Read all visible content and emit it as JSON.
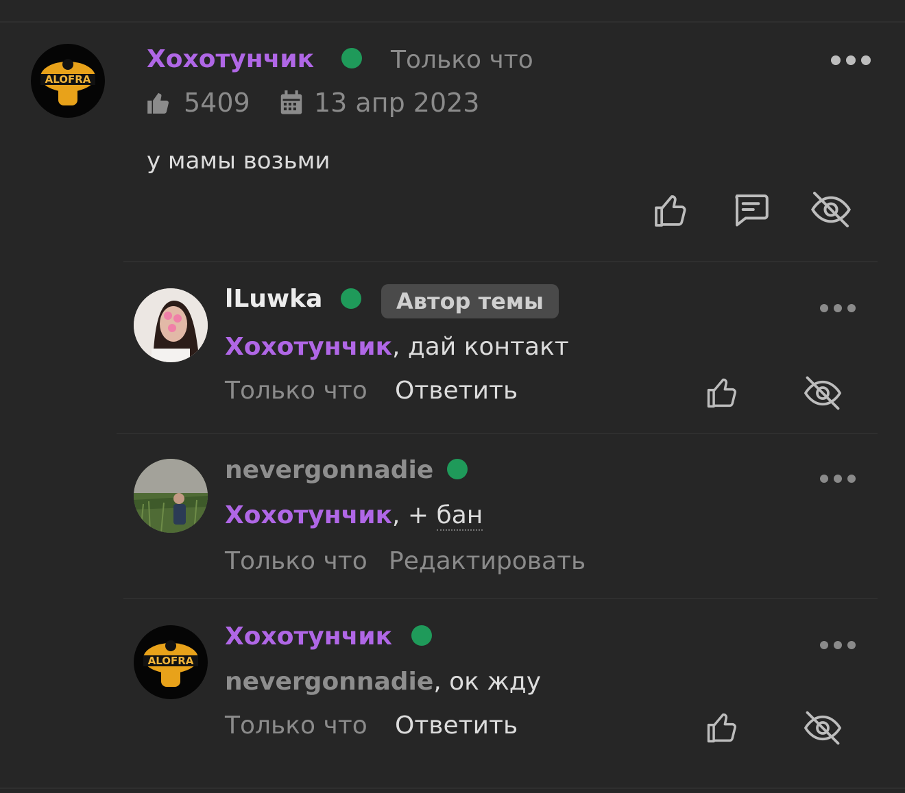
{
  "colors": {
    "background": "#262626",
    "accent_name": "#b067e6",
    "online": "#1f9a5a",
    "muted": "#8b8b8b"
  },
  "main_comment": {
    "author": "Хохотунчик",
    "time": "Только что",
    "likes": "5409",
    "date": "13 апр 2023",
    "text": "у мамы возьми",
    "icons": [
      "like-icon",
      "reply-icon",
      "hide-icon"
    ]
  },
  "replies": [
    {
      "author": "lLuwka",
      "badge": "Автор темы",
      "mention": "Хохотунчик",
      "text": ", дай контакт",
      "time": "Только что",
      "action": "Ответить"
    },
    {
      "author": "nevergonnadie",
      "mention": "Хохотунчик",
      "text_prefix": ", + ",
      "text_underlined": "бан",
      "time": "Только что",
      "action": "Редактировать"
    },
    {
      "author": "Хохотунчик",
      "mention": "nevergonnadie",
      "text": ", ок жду",
      "time": "Только что",
      "action": "Ответить"
    }
  ]
}
